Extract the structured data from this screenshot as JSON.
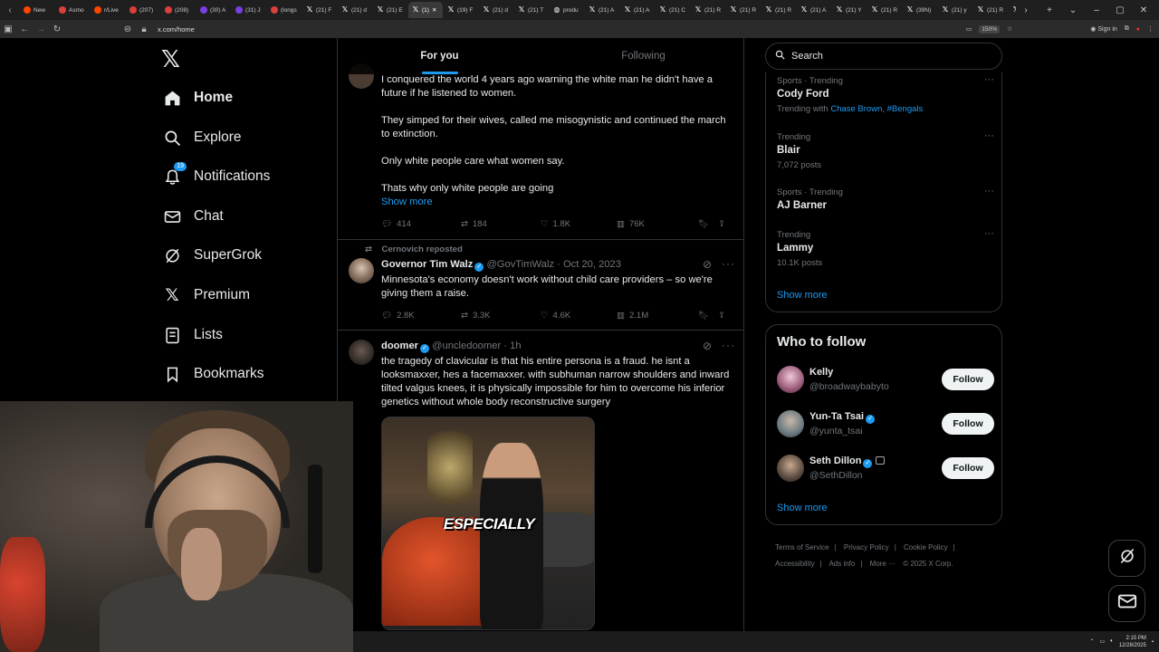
{
  "browser": {
    "tabs": [
      {
        "label": "New",
        "fav": "chrome"
      },
      {
        "label": "Asmo",
        "fav": "red"
      },
      {
        "label": "r/Live",
        "fav": "reddit"
      },
      {
        "label": "(207)",
        "fav": "red"
      },
      {
        "label": "(208)",
        "fav": "red"
      },
      {
        "label": "(30) A",
        "fav": "purple"
      },
      {
        "label": "(31) J",
        "fav": "purple"
      },
      {
        "label": "(longs",
        "fav": "red"
      },
      {
        "label": "(21) F",
        "fav": "x"
      },
      {
        "label": "(21) d",
        "fav": "x"
      },
      {
        "label": "(21) E",
        "fav": "x"
      },
      {
        "label": "(1)",
        "fav": "x"
      },
      {
        "label": "(19) F",
        "fav": "x"
      },
      {
        "label": "(21) d",
        "fav": "x"
      },
      {
        "label": "(21) T",
        "fav": "x"
      },
      {
        "label": "produ",
        "fav": "globe"
      },
      {
        "label": "(21) A",
        "fav": "x"
      },
      {
        "label": "(21) A",
        "fav": "x"
      },
      {
        "label": "(21) C",
        "fav": "x"
      },
      {
        "label": "(21) R",
        "fav": "x"
      },
      {
        "label": "(21) R",
        "fav": "x"
      },
      {
        "label": "(21) R",
        "fav": "x"
      },
      {
        "label": "(21) A",
        "fav": "x"
      },
      {
        "label": "(21) Y",
        "fav": "x"
      },
      {
        "label": "(21) R",
        "fav": "x"
      },
      {
        "label": "(39N)",
        "fav": "x"
      },
      {
        "label": "(21) y",
        "fav": "x"
      },
      {
        "label": "(21) R",
        "fav": "x"
      },
      {
        "label": "(21) F",
        "fav": "x"
      }
    ],
    "active_tab_index": 11,
    "url": "x.com/home",
    "zoom": "150%",
    "signin_label": "Sign in"
  },
  "nav": {
    "items": [
      {
        "label": "Home",
        "icon": "home-icon",
        "bold": true
      },
      {
        "label": "Explore",
        "icon": "search-icon"
      },
      {
        "label": "Notifications",
        "icon": "bell-icon",
        "badge": "19"
      },
      {
        "label": "Chat",
        "icon": "mail-icon"
      },
      {
        "label": "SuperGrok",
        "icon": "grok-icon"
      },
      {
        "label": "Premium",
        "icon": "x-logo-icon"
      },
      {
        "label": "Lists",
        "icon": "list-icon"
      },
      {
        "label": "Bookmarks",
        "icon": "bookmark-icon"
      }
    ]
  },
  "timeline": {
    "tabs": [
      "For you",
      "Following"
    ],
    "tweet1": {
      "lines": [
        "I conquered the world 4 years ago warning the white man he didn't have a future if he listened to women.",
        "They simped for their wives, called me misogynistic and continued the march to extinction.",
        "Only white people care what women say.",
        "Thats why only white people are going"
      ],
      "show_more": "Show more",
      "replies": "414",
      "reposts": "184",
      "likes": "1.8K",
      "views": "76K"
    },
    "tweet2": {
      "reposted_by": "Cernovich reposted",
      "name": "Governor Tim Walz",
      "handle": "@GovTimWalz",
      "date": "Oct 20, 2023",
      "text": "Minnesota's economy doesn't work without child care providers – so we're giving them a raise.",
      "replies": "2.8K",
      "reposts": "3.3K",
      "likes": "4.6K",
      "views": "2.1M"
    },
    "tweet3": {
      "name": "doomer",
      "handle": "@uncledoomer",
      "time": "1h",
      "text": "the tragedy of clavicular is that his entire persona is a fraud. he isnt a looksmaxxer, hes a facemaxxer. with subhuman narrow shoulders and inward tilted valgus knees, it is physically impossible for him to overcome his inferior genetics without whole body reconstructive surgery",
      "media_caption": "ESPECIALLY"
    }
  },
  "sidebar": {
    "search_placeholder": "Search",
    "trends": [
      {
        "category": "Sports · Trending",
        "name": "Cody Ford",
        "sub_prefix": "Trending with",
        "sub_links": "Chase Brown, #Bengals"
      },
      {
        "category": "Trending",
        "name": "Blair",
        "posts": "7,072 posts"
      },
      {
        "category": "Sports · Trending",
        "name": "AJ Barner"
      },
      {
        "category": "Trending",
        "name": "Lammy",
        "posts": "10.1K posts"
      }
    ],
    "trends_show_more": "Show more",
    "who_to_follow_title": "Who to follow",
    "who": [
      {
        "name": "Kelly",
        "handle": "@broadwaybabyto",
        "verified": false,
        "follow": "Follow"
      },
      {
        "name": "Yun-Ta Tsai",
        "handle": "@yunta_tsai",
        "verified": true,
        "follow": "Follow"
      },
      {
        "name": "Seth Dillon",
        "handle": "@SethDillon",
        "verified": true,
        "follow": "Follow"
      }
    ],
    "who_show_more": "Show more",
    "footer": [
      "Terms of Service",
      "|",
      "Privacy Policy",
      "|",
      "Cookie Policy",
      "|",
      "Accessibility",
      "|",
      "Ads info",
      "|",
      "More ···",
      "© 2025 X Corp."
    ]
  },
  "taskbar": {
    "time": "2:15 PM",
    "date": "12/28/2025"
  },
  "colors": {
    "accent": "#1d9bf0",
    "background": "#000000",
    "border": "#2f3336",
    "muted_text": "#71767b"
  }
}
